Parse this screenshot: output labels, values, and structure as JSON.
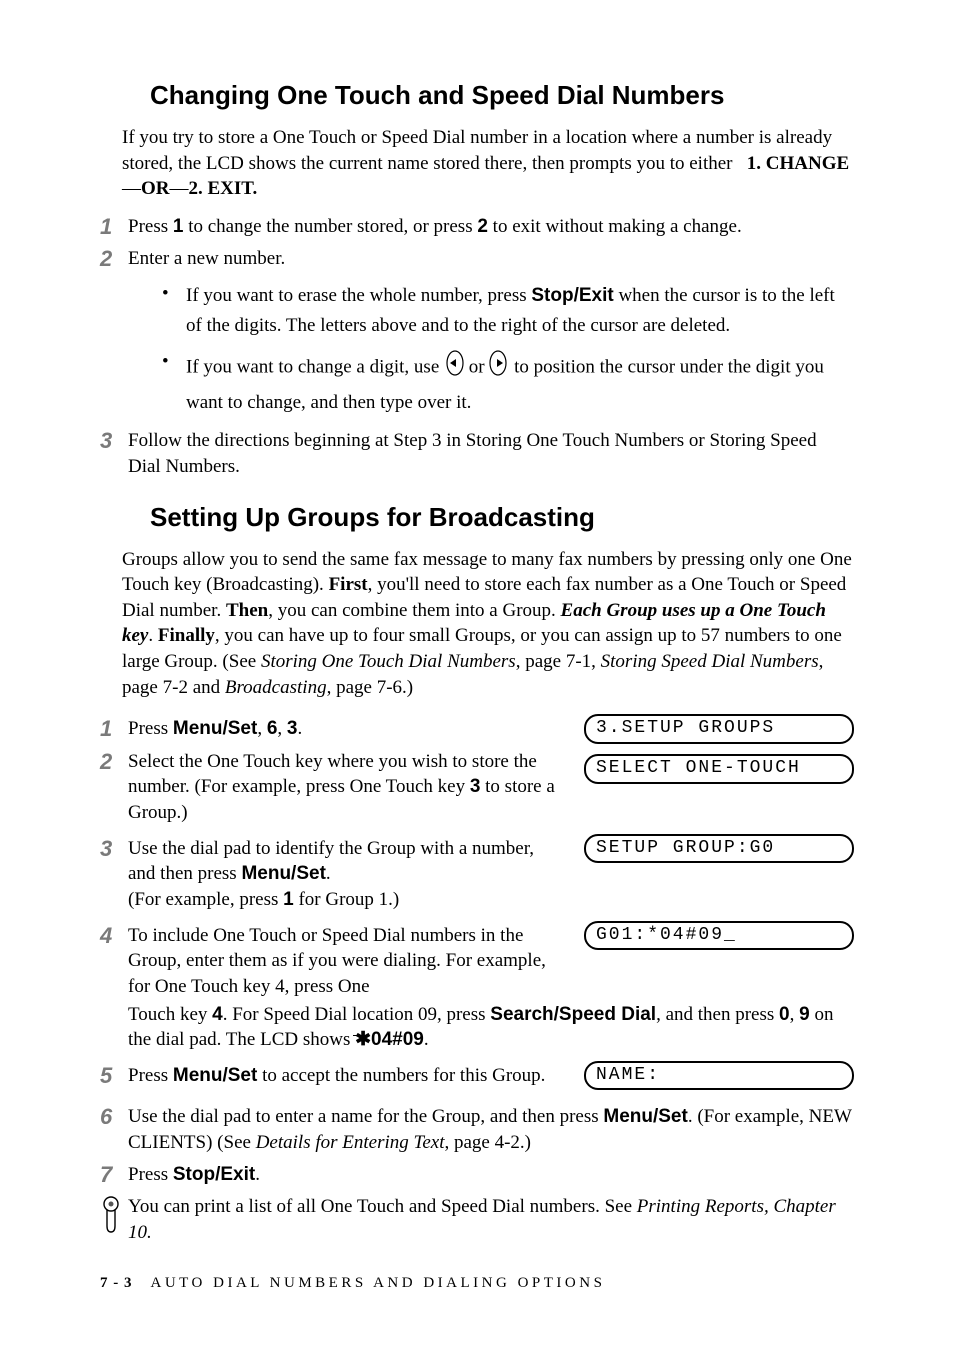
{
  "headings": {
    "h1": "Changing One Touch and Speed Dial Numbers",
    "h2": "Setting Up Groups for Broadcasting"
  },
  "intro1_a": "If you try to store a One Touch or Speed Dial number in a location where a number is already stored, the LCD shows the current name stored there, then prompts you to either   ",
  "intro1_b": "1. CHANGE",
  "intro1_c": "—",
  "intro1_d": "OR",
  "intro1_e": "—",
  "intro1_f": "2. EXIT.",
  "steps1": {
    "s1_a": "Press ",
    "s1_b": "1",
    "s1_c": " to change the number stored, or press ",
    "s1_d": "2",
    "s1_e": " to exit without making a change.",
    "s2": "Enter a new number.",
    "b1_a": "If you want to erase the whole number, press ",
    "b1_b": "Stop/Exit",
    "b1_c": " when the cursor is to the left of the digits. The letters above and to the right of the cursor are deleted.",
    "b2_a": "If you want to change a digit, use ",
    "b2_b": " or ",
    "b2_c": " to position the cursor under the digit you want to change, and then type over it.",
    "s3": "Follow the directions beginning at Step 3 in Storing One Touch Numbers or Storing Speed Dial Numbers."
  },
  "intro2_a": "Groups allow you to send the same fax message to many fax numbers by pressing only one One Touch key (Broadcasting). ",
  "intro2_b": "First",
  "intro2_c": ", you'll need to store each fax number as a One Touch or Speed Dial number. ",
  "intro2_d": "Then",
  "intro2_e": ", you can combine them into a Group. ",
  "intro2_f": "Each Group uses up a One Touch key",
  "intro2_g": ". ",
  "intro2_h": "Finally",
  "intro2_i": ", you can have up to four small Groups, or you can assign up to 57 numbers to one large Group. (See ",
  "intro2_j": "Storing One Touch Dial Numbers",
  "intro2_k": ", page 7-1, ",
  "intro2_l": "Storing Speed Dial Numbers",
  "intro2_m": ", page 7-2 and ",
  "intro2_n": "Broadcasting",
  "intro2_o": ", page 7-6.)",
  "steps2": {
    "s1_a": "Press ",
    "s1_b": "Menu/Set",
    "s1_c": ", ",
    "s1_d": "6",
    "s1_e": ", ",
    "s1_f": "3",
    "s1_g": ".",
    "s2_a": "Select the One Touch key where you wish to store the number.  (For example, press One Touch key ",
    "s2_b": "3",
    "s2_c": " to store a Group.)",
    "s3_a": "Use the dial pad to identify the Group with a number, and then press ",
    "s3_b": "Menu/Set",
    "s3_c": ".",
    "s3_d": "(For example, press ",
    "s3_e": "1",
    "s3_f": " for Group 1.)",
    "s4_a": "To include One Touch or Speed Dial numbers in the Group, enter them as if you were dialing. For example, for One Touch key 4, press One Touch key ",
    "s4_b": "4",
    "s4_c": ". For Speed Dial location 09, press ",
    "s4_d": "Search/Speed Dial",
    "s4_e": ", and then press ",
    "s4_f": "0",
    "s4_g": ", ",
    "s4_h": "9",
    "s4_i": " on the dial pad. The LCD shows ",
    "s4_j": "04#09",
    "s4_k": ".",
    "s5_a": "Press ",
    "s5_b": "Menu/Set",
    "s5_c": " to accept the numbers for this Group.",
    "s6_a": "Use the dial pad to enter a name for the Group, and then press ",
    "s6_b": "Menu/Set",
    "s6_c": ". (For example, NEW CLIENTS) (See ",
    "s6_d": "Details for Entering Text",
    "s6_e": ", page 4-2.)",
    "s7_a": "Press ",
    "s7_b": "Stop/Exit",
    "s7_c": "."
  },
  "lcd": {
    "l1": "3.SETUP GROUPS",
    "l2": "SELECT ONE-TOUCH",
    "l3": "SETUP GROUP:G0",
    "l4": "G01:*04#09_",
    "l5": "NAME:"
  },
  "note_a": "You can print a list of all One Touch and Speed Dial numbers.  See  ",
  "note_b": "Printing Reports, Chapter 10.",
  "footer": {
    "page": "7 - 3",
    "title": "AUTO DIAL NUMBERS AND DIALING OPTIONS"
  },
  "nums": {
    "n1": "1",
    "n2": "2",
    "n3": "3",
    "n4": "4",
    "n5": "5",
    "n6": "6",
    "n7": "7"
  }
}
